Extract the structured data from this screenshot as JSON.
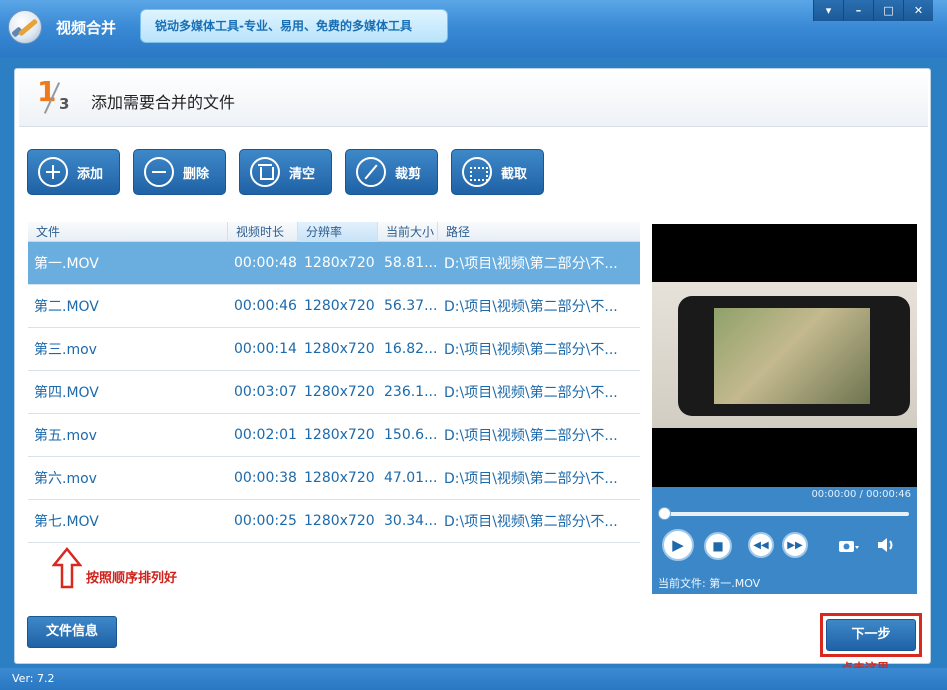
{
  "app": {
    "title": "视频合并",
    "slogan": "锐动多媒体工具-专业、易用、免费的多媒体工具",
    "version": "Ver: 7.2"
  },
  "window_controls": [
    "▾",
    "–",
    "□",
    "✕"
  ],
  "step": {
    "current": "1",
    "total": "3",
    "title": "添加需要合并的文件"
  },
  "toolbar": {
    "add": "添加",
    "delete": "删除",
    "clear": "清空",
    "trim": "裁剪",
    "crop": "截取"
  },
  "table": {
    "columns": [
      "文件",
      "视频时长",
      "分辨率",
      "当前大小",
      "路径"
    ],
    "sorted_column": "分辨率",
    "rows": [
      {
        "file": "第一.MOV",
        "duration": "00:00:48",
        "resolution": "1280x720",
        "size": "58.81...",
        "path": "D:\\项目\\视频\\第二部分\\不..."
      },
      {
        "file": "第二.MOV",
        "duration": "00:00:46",
        "resolution": "1280x720",
        "size": "56.37...",
        "path": "D:\\项目\\视频\\第二部分\\不..."
      },
      {
        "file": "第三.mov",
        "duration": "00:00:14",
        "resolution": "1280x720",
        "size": "16.82...",
        "path": "D:\\项目\\视频\\第二部分\\不..."
      },
      {
        "file": "第四.MOV",
        "duration": "00:03:07",
        "resolution": "1280x720",
        "size": "236.1...",
        "path": "D:\\项目\\视频\\第二部分\\不..."
      },
      {
        "file": "第五.mov",
        "duration": "00:02:01",
        "resolution": "1280x720",
        "size": "150.6...",
        "path": "D:\\项目\\视频\\第二部分\\不..."
      },
      {
        "file": "第六.mov",
        "duration": "00:00:38",
        "resolution": "1280x720",
        "size": "47.01...",
        "path": "D:\\项目\\视频\\第二部分\\不..."
      },
      {
        "file": "第七.MOV",
        "duration": "00:00:25",
        "resolution": "1280x720",
        "size": "30.34...",
        "path": "D:\\项目\\视频\\第二部分\\不..."
      }
    ],
    "selected_index": 0
  },
  "annotation": {
    "arrow_text": "按照顺序排列好",
    "click_text": "点击这里"
  },
  "player": {
    "time": "00:00:00 / 00:00:46",
    "current_file": "当前文件: 第一.MOV",
    "progress": 0
  },
  "buttons": {
    "file_info": "文件信息",
    "next": "下一步"
  },
  "colors": {
    "accent": "#2d7fc4",
    "selected_row": "#6aaee0",
    "annotation": "#d8281f",
    "step_number": "#f07a1a"
  }
}
